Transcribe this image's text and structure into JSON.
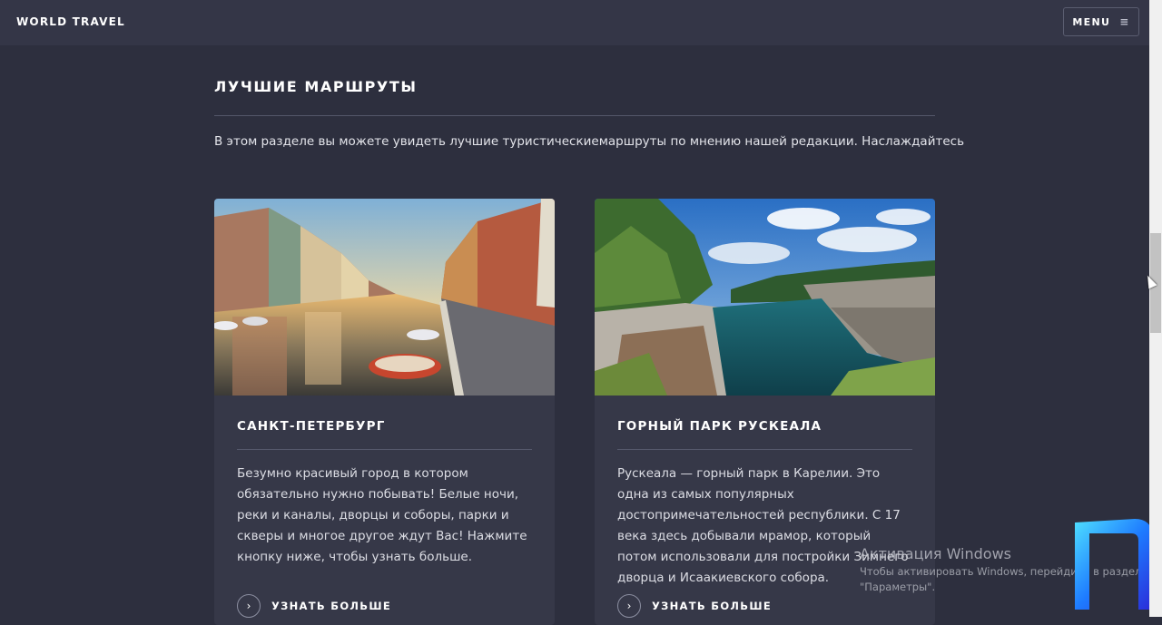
{
  "header": {
    "brand": "WORLD TRAVEL",
    "menu_label": "MENU",
    "menu_icon": "hamburger-icon"
  },
  "section": {
    "title": "ЛУЧШИЕ МАРШРУТЫ",
    "description": "В этом разделе вы можете увидеть лучшие туристическиемаршруты по мнению нашей редакции. Наслаждайтесь"
  },
  "cards": [
    {
      "title": "САНКТ-ПЕТЕРБУРГ",
      "text": "Безумно красивый город в котором обязательно нужно побывать! Белые ночи, реки и каналы, дворцы и соборы, парки и скверы и многое другое ждут Вас! Нажмите кнопку ниже, чтобы узнать больше.",
      "more_label": "УЗНАТЬ БОЛЬШЕ",
      "more_icon": "chevron-right-icon"
    },
    {
      "title": "ГОРНЫЙ ПАРК РУСКЕАЛА",
      "text": "Рускеала — горный парк в Карелии. Это одна из самых популярных достопримечательностей республики. С 17 века здесь добывали мрамор, который потом использовали для постройки Зимнего дворца и Исаакиевского собора.",
      "more_label": "УЗНАТЬ БОЛЬШЕ",
      "more_icon": "chevron-right-icon"
    }
  ],
  "watermark": {
    "title": "Активация Windows",
    "line1": "Чтобы активировать Windows, перейдите в раздел",
    "line2": "\"Параметры\"."
  },
  "colors": {
    "background": "#2d2f3e",
    "header": "#343647",
    "card": "#363848",
    "accent": "#1e90ff"
  }
}
